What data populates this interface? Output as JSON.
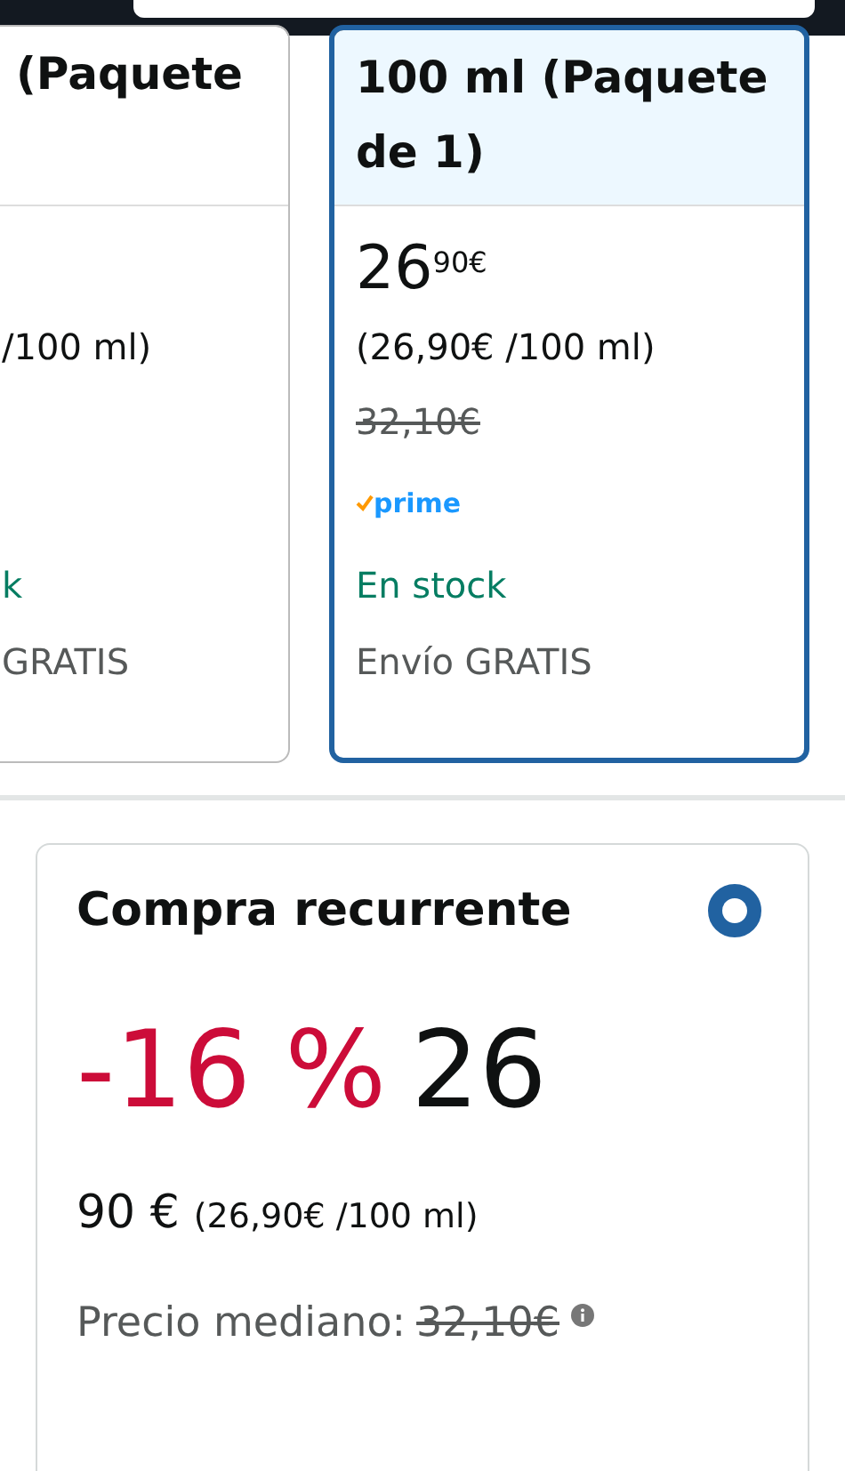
{
  "options": [
    {
      "title": "(Paquete",
      "unit_price": "/100 ml)",
      "stock": "k",
      "shipping": "GRATIS",
      "selected": false
    },
    {
      "title": "100 ml (Paquete de 1)",
      "price_whole": "26",
      "price_fraction": "90€",
      "unit_price": "(26,90€ /100 ml)",
      "list_price": "32,10€",
      "prime_badge": "prime",
      "stock": "En stock",
      "shipping": "Envío GRATIS",
      "selected": true
    }
  ],
  "recurring": {
    "title": "Compra recurrente",
    "selected": true,
    "discount": "-16 %",
    "price_whole": "26",
    "price_rest": "90 €",
    "unit_price": "(26,90€ /100 ml)",
    "median_label": "Precio mediano:",
    "median_price": "32,10€"
  }
}
